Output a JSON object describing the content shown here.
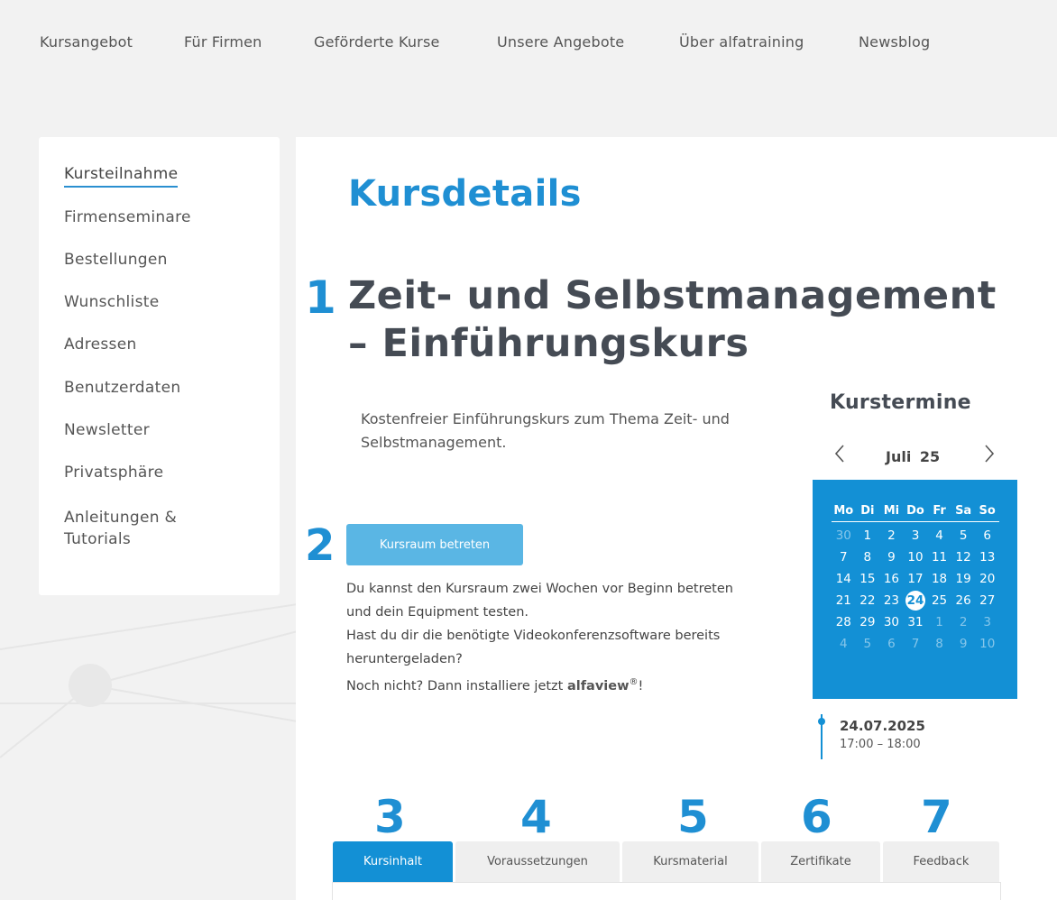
{
  "topnav": {
    "items": [
      "Kursangebot",
      "Für Firmen",
      "Geförderte Kurse",
      "Unsere Angebote",
      "Über alfatraining",
      "Newsblog"
    ]
  },
  "sidebar": {
    "items": [
      {
        "label": "Kursteilnahme",
        "active": true
      },
      {
        "label": "Firmenseminare"
      },
      {
        "label": "Bestellungen"
      },
      {
        "label": "Wunschliste"
      },
      {
        "label": "Adressen"
      },
      {
        "label": "Benutzerdaten"
      },
      {
        "label": "Newsletter"
      },
      {
        "label": "Privatsphäre"
      },
      {
        "label": "Anleitungen &"
      },
      {
        "label": "Tutorials"
      }
    ]
  },
  "main": {
    "page_title": "Kursdetails",
    "markers": [
      "1",
      "2",
      "3",
      "4",
      "5",
      "6",
      "7"
    ],
    "course_title": "Zeit- und Selbstmanagement – Einführungskurs",
    "description": "Kostenfreier Einführungskurs zum Thema Zeit- und Selbstmanagement.",
    "enter_button": "Kursraum betreten",
    "info_line1": "Du kannst den Kursraum zwei Wochen vor Beginn betreten",
    "info_line2": "und dein Equipment testen.",
    "info_line3": "Hast du dir die benötigte Videokonferenzsoftware bereits",
    "info_line4": "heruntergeladen?",
    "info_line5_pre": "Noch nicht? Dann installiere jetzt ",
    "info_brand": "alfaview",
    "info_reg": "®",
    "info_line5_post": "!"
  },
  "calendar": {
    "heading": "Kurstermine",
    "prev_icon": "chevron-left-icon",
    "next_icon": "chevron-right-icon",
    "month": "Juli",
    "year": "25",
    "weekdays": [
      "Mo",
      "Di",
      "Mi",
      "Do",
      "Fr",
      "Sa",
      "So"
    ],
    "weeks": [
      [
        {
          "d": "30",
          "muted": true
        },
        {
          "d": "1"
        },
        {
          "d": "2"
        },
        {
          "d": "3"
        },
        {
          "d": "4"
        },
        {
          "d": "5"
        },
        {
          "d": "6"
        }
      ],
      [
        {
          "d": "7"
        },
        {
          "d": "8"
        },
        {
          "d": "9"
        },
        {
          "d": "10"
        },
        {
          "d": "11"
        },
        {
          "d": "12"
        },
        {
          "d": "13"
        }
      ],
      [
        {
          "d": "14"
        },
        {
          "d": "15"
        },
        {
          "d": "16"
        },
        {
          "d": "17"
        },
        {
          "d": "18"
        },
        {
          "d": "19"
        },
        {
          "d": "20"
        }
      ],
      [
        {
          "d": "21"
        },
        {
          "d": "22"
        },
        {
          "d": "23"
        },
        {
          "d": "24",
          "selected": true
        },
        {
          "d": "25"
        },
        {
          "d": "26"
        },
        {
          "d": "27"
        }
      ],
      [
        {
          "d": "28"
        },
        {
          "d": "29"
        },
        {
          "d": "30"
        },
        {
          "d": "31"
        },
        {
          "d": "1",
          "muted": true
        },
        {
          "d": "2",
          "muted": true
        },
        {
          "d": "3",
          "muted": true
        }
      ],
      [
        {
          "d": "4",
          "muted": true
        },
        {
          "d": "5",
          "muted": true
        },
        {
          "d": "6",
          "muted": true
        },
        {
          "d": "7",
          "muted": true
        },
        {
          "d": "8",
          "muted": true
        },
        {
          "d": "9",
          "muted": true
        },
        {
          "d": "10",
          "muted": true
        }
      ]
    ],
    "event_date": "24.07.2025",
    "event_time": "17:00 – 18:00"
  },
  "tabs": [
    {
      "label": "Kursinhalt",
      "active": true
    },
    {
      "label": "Voraussetzungen"
    },
    {
      "label": "Kursmaterial"
    },
    {
      "label": "Zertifikate"
    },
    {
      "label": "Feedback"
    }
  ],
  "colors": {
    "accent": "#1390d5",
    "button": "#5ab6e4",
    "title_dark": "#454b54"
  }
}
